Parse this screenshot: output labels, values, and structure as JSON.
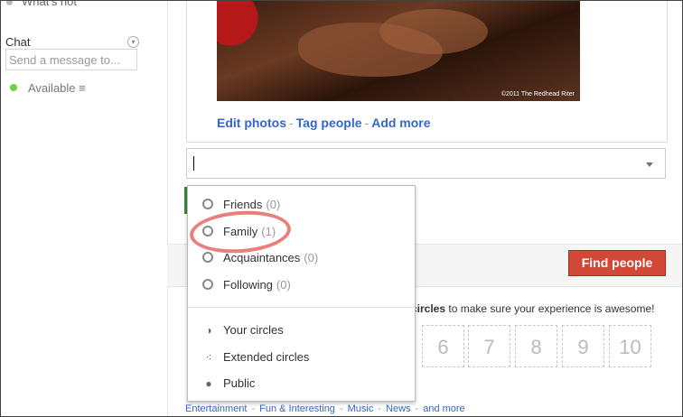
{
  "sidebar": {
    "whats_hot": "What's hot",
    "chat_title": "Chat",
    "chat_placeholder": "Send a message to...",
    "status_label": "Available"
  },
  "post": {
    "photo_credit": "©2011 The Redhead Riter",
    "actions": [
      "Edit photos",
      "Tag people",
      "Add more"
    ]
  },
  "share": {
    "value": ""
  },
  "circles_menu": {
    "circles": [
      {
        "label": "Friends",
        "count": "(0)"
      },
      {
        "label": "Family",
        "count": "(1)"
      },
      {
        "label": "Acquaintances",
        "count": "(0)"
      },
      {
        "label": "Following",
        "count": "(0)"
      }
    ],
    "audiences": [
      {
        "label": "Your circles",
        "icon": "your-circles-icon"
      },
      {
        "label": "Extended circles",
        "icon": "extended-circles-icon"
      },
      {
        "label": "Public",
        "icon": "globe-icon"
      }
    ]
  },
  "find_people_label": "Find people",
  "tip": {
    "strong": "circles",
    "rest": " to make sure your experience is awesome!"
  },
  "number_boxes": [
    "6",
    "7",
    "8",
    "9",
    "10"
  ],
  "footer_links": [
    "Entertainment",
    "Fun & Interesting",
    "Music",
    "News",
    "and more"
  ],
  "colors": {
    "accent_link": "#3366cc",
    "find_people_bg": "#d14836",
    "highlight_ring": "#e8706c",
    "status_available": "#6ed244"
  }
}
